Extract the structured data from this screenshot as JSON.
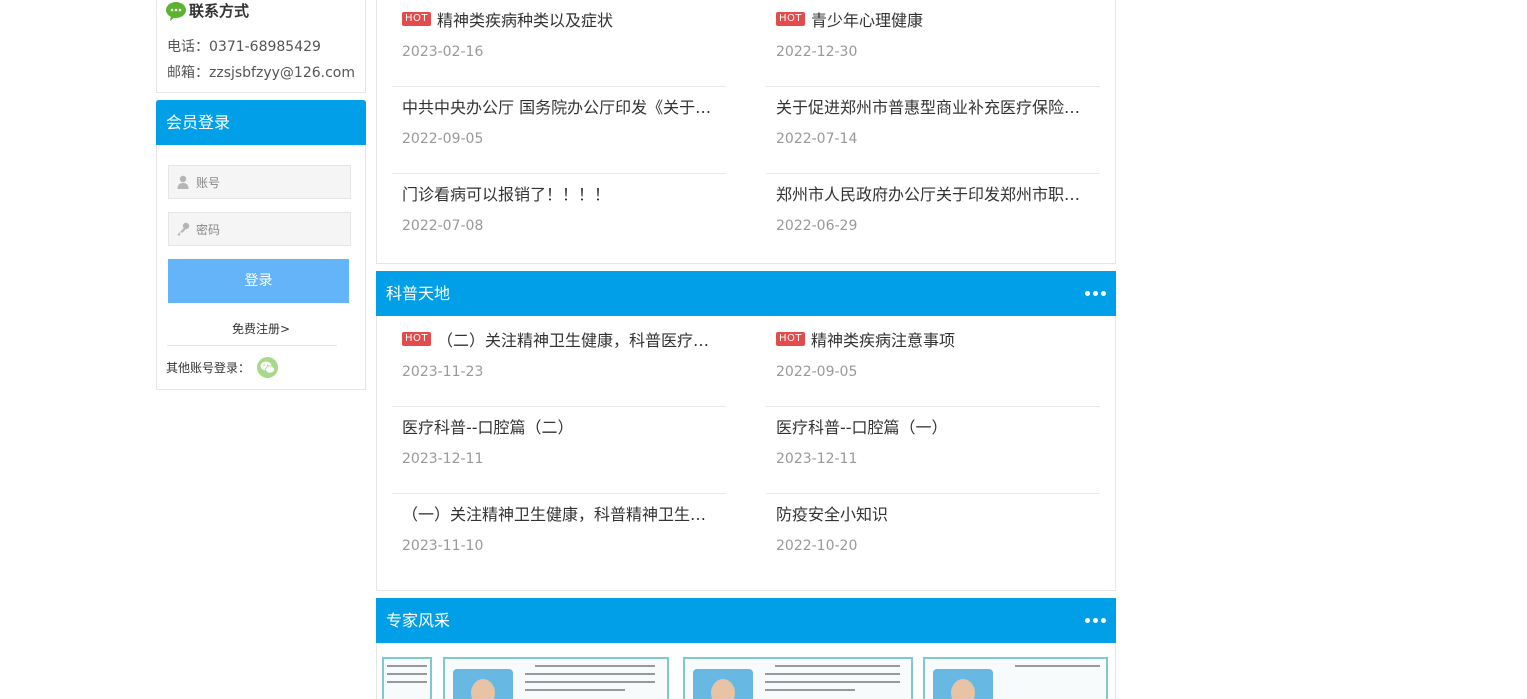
{
  "contact": {
    "title": "联系方式",
    "phone": "电话：0371-68985429",
    "email": "邮箱：zzsjsbfzyy@126.com"
  },
  "login": {
    "title": "会员登录",
    "account_placeholder": "账号",
    "password_placeholder": "密码",
    "login_button": "登录",
    "register_link": "免费注册>",
    "other_login_label": "其他账号登录："
  },
  "news_top": {
    "items": [
      {
        "title": "精神类疾病种类以及症状",
        "date": "2023-02-16",
        "hot": "HOT"
      },
      {
        "title": "青少年心理健康",
        "date": "2022-12-30",
        "hot": "HOT"
      },
      {
        "title": "中共中央办公厅 国务院办公厅印发《关于加强…",
        "date": "2022-09-05",
        "hot": ""
      },
      {
        "title": "关于促进郑州市普惠型商业补充医疗保险发展…",
        "date": "2022-07-14",
        "hot": ""
      },
      {
        "title": "门诊看病可以报销了！！！！",
        "date": "2022-07-08",
        "hot": ""
      },
      {
        "title": "郑州市人民政府办公厅关于印发郑州市职工基…",
        "date": "2022-06-29",
        "hot": ""
      }
    ]
  },
  "science": {
    "title": "科普天地",
    "items": [
      {
        "title": "（二）关注精神卫生健康，科普医疗知识…",
        "date": "2023-11-23",
        "hot": "HOT"
      },
      {
        "title": "精神类疾病注意事项",
        "date": "2022-09-05",
        "hot": "HOT"
      },
      {
        "title": "医疗科普--口腔篇（二）",
        "date": "2023-12-11",
        "hot": ""
      },
      {
        "title": "医疗科普--口腔篇（一）",
        "date": "2023-12-11",
        "hot": ""
      },
      {
        "title": "（一）关注精神卫生健康，科普精神卫生知识…",
        "date": "2023-11-10",
        "hot": ""
      },
      {
        "title": "防疫安全小知识",
        "date": "2022-10-20",
        "hot": ""
      }
    ]
  },
  "experts": {
    "title": "专家风采"
  },
  "colors": {
    "header_blue": "#009fe8",
    "login_button": "#63b4f8",
    "hot_red": "#e44b4b"
  }
}
